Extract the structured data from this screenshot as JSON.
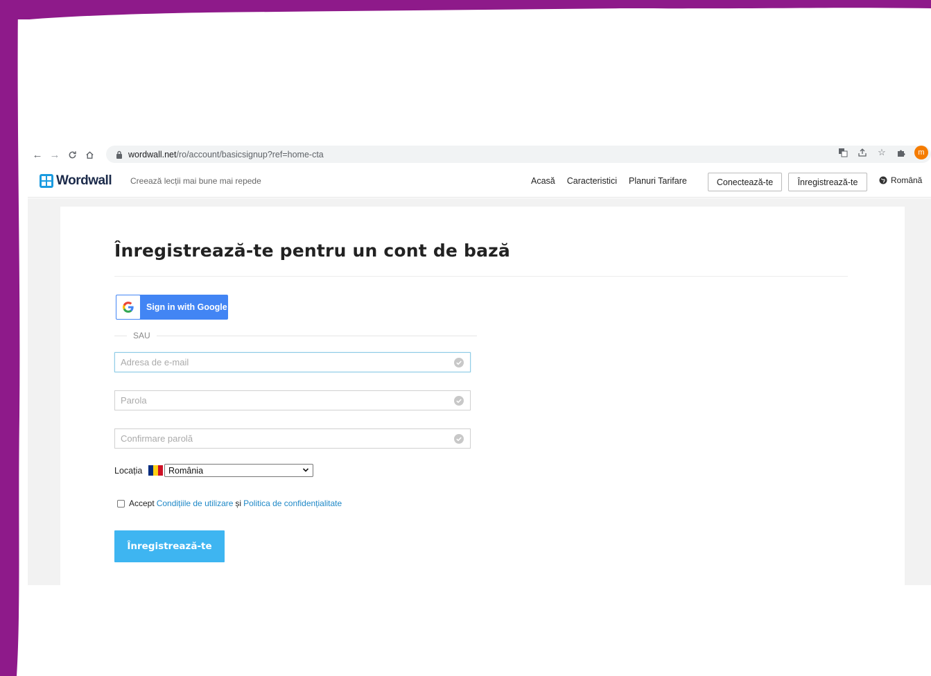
{
  "browser": {
    "url_host": "wordwall.net",
    "url_path": "/ro/account/basicsignup?ref=home-cta",
    "avatar_initial": "m"
  },
  "header": {
    "logo_text": "Wordwall",
    "tagline": "Creează lecții mai bune mai repede",
    "nav": [
      "Acasă",
      "Caracteristici",
      "Planuri Tarifare"
    ],
    "login_label": "Conectează-te",
    "signup_label": "Înregistrează-te",
    "language": "Română"
  },
  "form": {
    "title": "Înregistrează-te pentru un cont de bază",
    "google_label": "Sign in with Google",
    "or_text": "SAU",
    "email_placeholder": "Adresa de e-mail",
    "password_placeholder": "Parola",
    "confirm_placeholder": "Confirmare parolă",
    "location_label": "Locația",
    "country_selected": "România",
    "accept_text": "Accept",
    "terms_link": "Condițiile de utilizare",
    "and_text": "și",
    "privacy_link": "Politica de confidențialitate",
    "submit_label": "Înregistrează-te"
  },
  "colors": {
    "frame": "#8e1a8a",
    "google_blue": "#4285f4",
    "submit_blue": "#3eb5f1",
    "link": "#1e88c7",
    "flag": [
      "#002b7f",
      "#fcd116",
      "#ce1126"
    ]
  }
}
